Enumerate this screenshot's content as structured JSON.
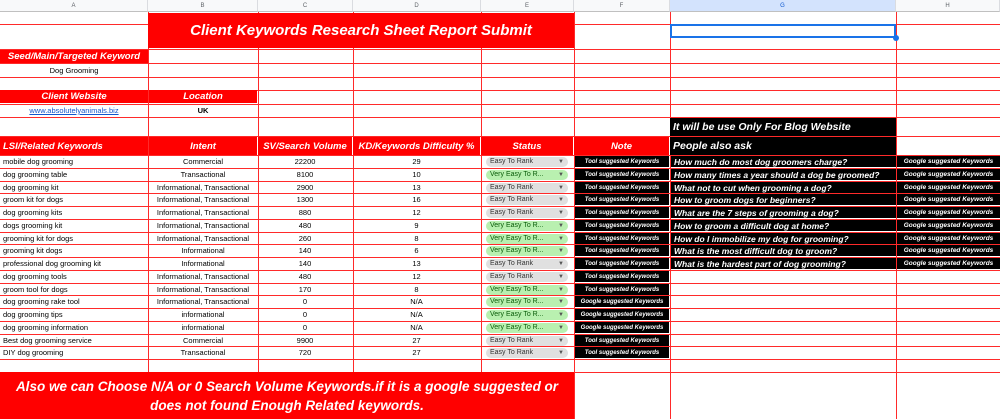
{
  "columns": [
    "A",
    "B",
    "C",
    "D",
    "E",
    "F",
    "G",
    "H"
  ],
  "selected_column": "G",
  "title": "Client Keywords Research Sheet Report Submit",
  "seed": {
    "label": "Seed/Main/Targeted Keyword",
    "value": "Dog Grooming"
  },
  "client": {
    "website_label": "Client Website",
    "website_value": "www.absolutelyanimals.biz",
    "location_label": "Location",
    "location_value": "UK"
  },
  "blog_note": "It will be use Only For Blog Website",
  "people_also_ask_label": "People also ask",
  "table_headers": {
    "keyword": "LSI/Related Keywords",
    "intent": "Intent",
    "volume": "SV/Search Volume",
    "kd": "KD/Keywords Difficulty %",
    "status": "Status",
    "note": "Note"
  },
  "status_colors": {
    "Easy To Rank": "#e0e0e0",
    "Very Easy To R...": "#b9f0b0"
  },
  "dropdown_icon": "caret-down-icon",
  "rows": [
    {
      "keyword": "mobile dog grooming",
      "intent": "Commercial",
      "volume": "22200",
      "kd": "29",
      "status": "Easy To Rank",
      "note": "Tool suggested Keywords"
    },
    {
      "keyword": "dog grooming table",
      "intent": "Transactional",
      "volume": "8100",
      "kd": "10",
      "status": "Very Easy To R...",
      "note": "Tool suggested Keywords"
    },
    {
      "keyword": "dog grooming kit",
      "intent": "Informational, Transactional",
      "volume": "2900",
      "kd": "13",
      "status": "Easy To Rank",
      "note": "Tool suggested Keywords"
    },
    {
      "keyword": "groom kit for dogs",
      "intent": "Informational, Transactional",
      "volume": "1300",
      "kd": "16",
      "status": "Easy To Rank",
      "note": "Tool suggested Keywords"
    },
    {
      "keyword": "dog grooming kits",
      "intent": "Informational, Transactional",
      "volume": "880",
      "kd": "12",
      "status": "Easy To Rank",
      "note": "Tool suggested Keywords"
    },
    {
      "keyword": "dogs grooming kit",
      "intent": "Informational, Transactional",
      "volume": "480",
      "kd": "9",
      "status": "Very Easy To R...",
      "note": "Tool suggested Keywords"
    },
    {
      "keyword": "grooming kit for dogs",
      "intent": "Informational, Transactional",
      "volume": "260",
      "kd": "8",
      "status": "Very Easy To R...",
      "note": "Tool suggested Keywords"
    },
    {
      "keyword": "grooming kit dogs",
      "intent": "Informational",
      "volume": "140",
      "kd": "6",
      "status": "Very Easy To R...",
      "note": "Tool suggested Keywords"
    },
    {
      "keyword": "professional dog grooming kit",
      "intent": "Informational",
      "volume": "140",
      "kd": "13",
      "status": "Easy To Rank",
      "note": "Tool suggested Keywords"
    },
    {
      "keyword": "dog grooming tools",
      "intent": "Informational, Transactional",
      "volume": "480",
      "kd": "12",
      "status": "Easy To Rank",
      "note": "Tool suggested Keywords"
    },
    {
      "keyword": "groom tool for dogs",
      "intent": "Informational, Transactional",
      "volume": "170",
      "kd": "8",
      "status": "Very Easy To R...",
      "note": "Tool suggested Keywords"
    },
    {
      "keyword": "dog grooming rake tool",
      "intent": "Informational, Transactional",
      "volume": "0",
      "kd": "N/A",
      "status": "Very Easy To R...",
      "note": "Google suggested Keywords"
    },
    {
      "keyword": " dog grooming tips",
      "intent": "informational",
      "volume": "0",
      "kd": "N/A",
      "status": "Very Easy To R...",
      "note": "Google suggested Keywords"
    },
    {
      "keyword": "dog grooming information",
      "intent": "informational",
      "volume": "0",
      "kd": "N/A",
      "status": "Very Easy To R...",
      "note": "Google suggested Keywords"
    },
    {
      "keyword": "Best dog grooming service",
      "intent": "Commercial",
      "volume": "9900",
      "kd": "27",
      "status": "Easy To Rank",
      "note": "Tool suggested Keywords"
    },
    {
      "keyword": "DIY dog grooming",
      "intent": "Transactional",
      "volume": "720",
      "kd": "27",
      "status": "Easy To Rank",
      "note": "Tool suggested Keywords"
    }
  ],
  "questions": [
    {
      "question": "How much do most dog groomers charge?",
      "source": "Google suggested Keywords"
    },
    {
      "question": "How many times a year should a dog be groomed?",
      "source": "Google suggested Keywords"
    },
    {
      "question": "What not to cut when grooming a dog?",
      "source": "Google suggested Keywords"
    },
    {
      "question": "How to groom dogs for beginners?",
      "source": "Google suggested Keywords"
    },
    {
      "question": "What are the 7 steps of grooming a dog?",
      "source": "Google suggested Keywords"
    },
    {
      "question": "How to groom a difficult dog at home?",
      "source": "Google suggested Keywords"
    },
    {
      "question": "How do I immobilize my dog for grooming?",
      "source": "Google suggested Keywords"
    },
    {
      "question": "What is the most difficult dog to groom?",
      "source": "Google suggested Keywords"
    },
    {
      "question": "What is the hardest part of dog grooming?",
      "source": "Google suggested Keywords"
    }
  ],
  "footer_text": "Also we can Choose N/A or 0 Search Volume Keywords.if it is a google suggested or does not found Enough Related keywords."
}
